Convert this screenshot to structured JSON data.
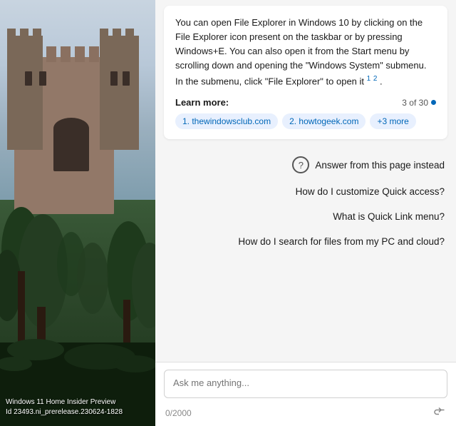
{
  "wallpaper": {
    "label1": "Windows 11 Home Insider Preview",
    "label2": "Id 23493.ni_prerelease.230624-1828"
  },
  "answer": {
    "text_part1": "You can open File Explorer in Windows 10 by clicking on the File Explorer icon present on the taskbar or by pressing Windows+E. You can also open it from the Start menu by scrolling down and opening the \"Windows System\" submenu. In the submenu, click \"File Explorer\" to open it",
    "sup1": "1",
    "sup2": "2",
    "learn_more_label": "Learn more:",
    "page_counter": "3 of 30",
    "sources": [
      "1. thewindowsclub.com",
      "2. howtogeek.com",
      "+3 more"
    ]
  },
  "suggestions": {
    "answer_from_page": "Answer from this page instead",
    "items": [
      "How do I customize Quick access?",
      "What is Quick Link menu?",
      "How do I search for files from my PC and cloud?"
    ]
  },
  "input": {
    "placeholder": "Ask me anything...",
    "char_count": "0/2000"
  }
}
